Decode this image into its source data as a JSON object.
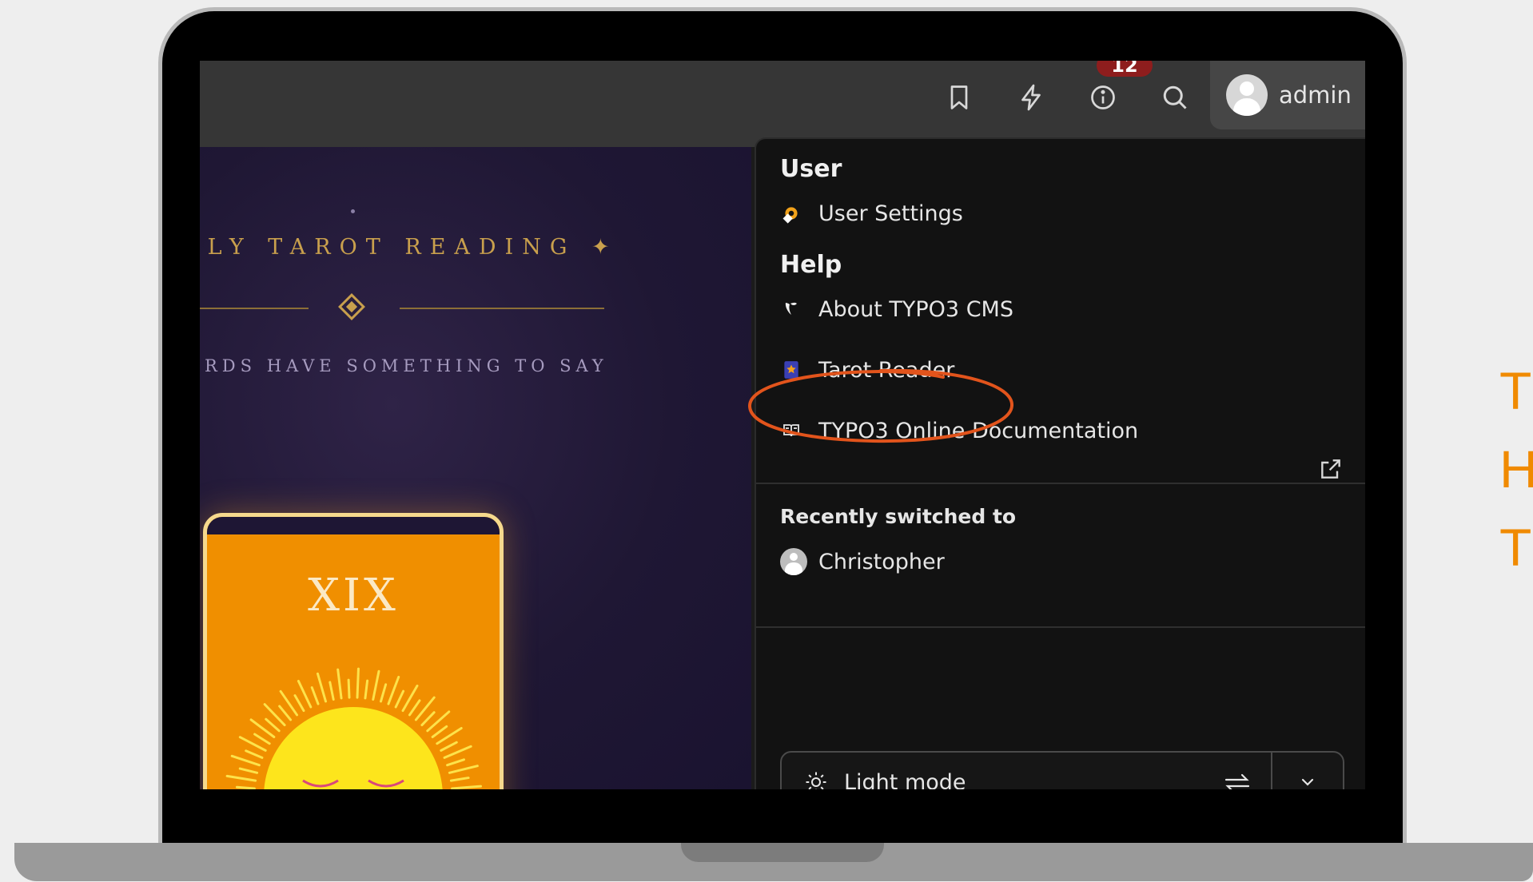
{
  "topbar": {
    "badge_count": "12",
    "user": {
      "name": "admin"
    },
    "icons": [
      "bookmark-icon",
      "flash-icon",
      "info-icon",
      "search-icon"
    ]
  },
  "content": {
    "title": "ILY TAROT READING ✦",
    "subtitle": "RDS HAVE SOMETHING TO SAY",
    "card": {
      "numeral": "XIX"
    }
  },
  "dropdown": {
    "user_heading": "User",
    "user_settings": "User Settings",
    "help_heading": "Help",
    "about": "About TYPO3 CMS",
    "tarot": "Tarot Reader",
    "docs": "TYPO3 Online Documentation",
    "recent_heading": "Recently switched to",
    "recent_user": "Christopher",
    "mode": {
      "selected": "Light mode"
    }
  },
  "side_text": [
    "T",
    "H",
    "T"
  ],
  "colors": {
    "accent_orange": "#f08a00",
    "badge_red": "#8e1d1d",
    "highlight_stroke": "#e2541c",
    "gold": "#c9a04d"
  }
}
